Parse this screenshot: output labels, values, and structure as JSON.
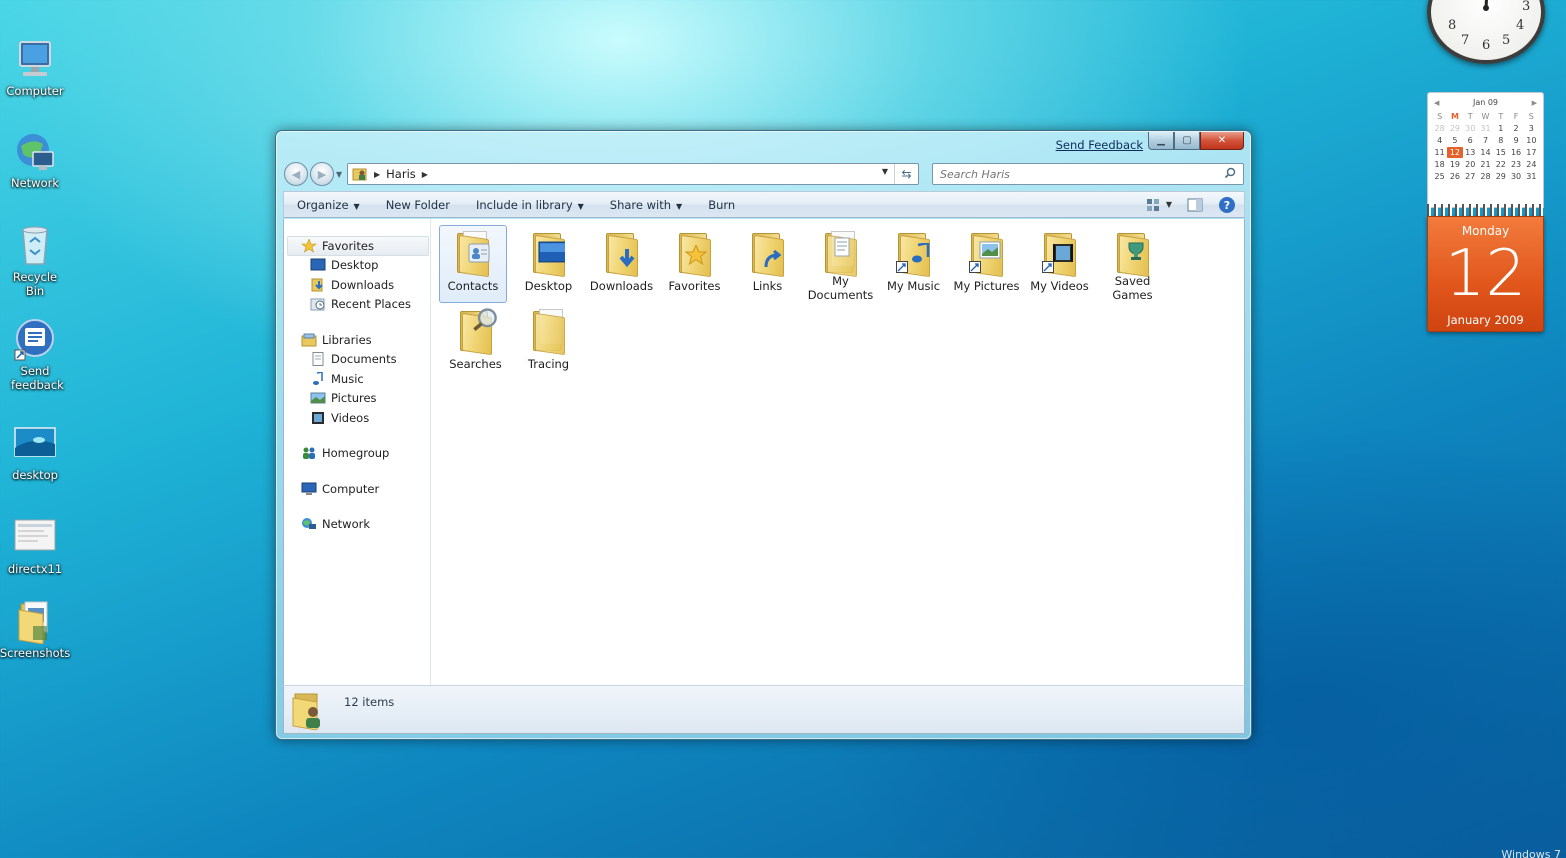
{
  "desktop": {
    "icons": [
      {
        "label": "Computer"
      },
      {
        "label": "Network"
      },
      {
        "label": "Recycle Bin"
      },
      {
        "label": "Send feedback"
      },
      {
        "label": "desktop"
      },
      {
        "label": "directx11"
      },
      {
        "label": "Screenshots"
      }
    ],
    "brand_text": "Windows 7"
  },
  "window": {
    "send_feedback": "Send Feedback",
    "address": {
      "segments": [
        "Haris"
      ]
    },
    "search_placeholder": "Search Haris",
    "toolbar": {
      "organize": "Organize",
      "new_folder": "New Folder",
      "include_in_library": "Include in library",
      "share_with": "Share with",
      "burn": "Burn"
    },
    "nav_pane": {
      "favorites": {
        "label": "Favorites",
        "items": [
          "Desktop",
          "Downloads",
          "Recent Places"
        ]
      },
      "libraries": {
        "label": "Libraries",
        "items": [
          "Documents",
          "Music",
          "Pictures",
          "Videos"
        ]
      },
      "homegroup": "Homegroup",
      "computer": "Computer",
      "network": "Network"
    },
    "files": [
      {
        "name": "Contacts",
        "icon": "contacts-folder-icon"
      },
      {
        "name": "Desktop",
        "icon": "desktop-folder-icon"
      },
      {
        "name": "Downloads",
        "icon": "downloads-folder-icon"
      },
      {
        "name": "Favorites",
        "icon": "favorites-folder-icon"
      },
      {
        "name": "Links",
        "icon": "links-folder-icon"
      },
      {
        "name": "My Documents",
        "icon": "documents-folder-icon"
      },
      {
        "name": "My Music",
        "icon": "music-folder-icon"
      },
      {
        "name": "My Pictures",
        "icon": "pictures-folder-icon"
      },
      {
        "name": "My Videos",
        "icon": "videos-folder-icon"
      },
      {
        "name": "Saved Games",
        "icon": "saved-games-folder-icon"
      },
      {
        "name": "Searches",
        "icon": "searches-folder-icon"
      },
      {
        "name": "Tracing",
        "icon": "folder-icon"
      }
    ],
    "status": {
      "item_count": "12 items"
    }
  },
  "gadgets": {
    "clock": {
      "numerals": [
        "8",
        "7",
        "6",
        "5",
        "4",
        "3"
      ]
    },
    "calendar": {
      "month_header": "Jan 09",
      "days_of_week": [
        "S",
        "M",
        "T",
        "W",
        "T",
        "F",
        "S"
      ],
      "weeks": [
        [
          "28",
          "29",
          "30",
          "31",
          "1",
          "2",
          "3"
        ],
        [
          "4",
          "5",
          "6",
          "7",
          "8",
          "9",
          "10"
        ],
        [
          "11",
          "12",
          "13",
          "14",
          "15",
          "16",
          "17"
        ],
        [
          "18",
          "19",
          "20",
          "21",
          "22",
          "23",
          "24"
        ],
        [
          "25",
          "26",
          "27",
          "28",
          "29",
          "30",
          "31"
        ]
      ],
      "weekday": "Monday",
      "day": "12",
      "month_year": "January 2009"
    }
  },
  "colors": {
    "accent_orange": "#e4622a",
    "link_blue": "#0f2c5c",
    "close_red": "#c0341c"
  }
}
